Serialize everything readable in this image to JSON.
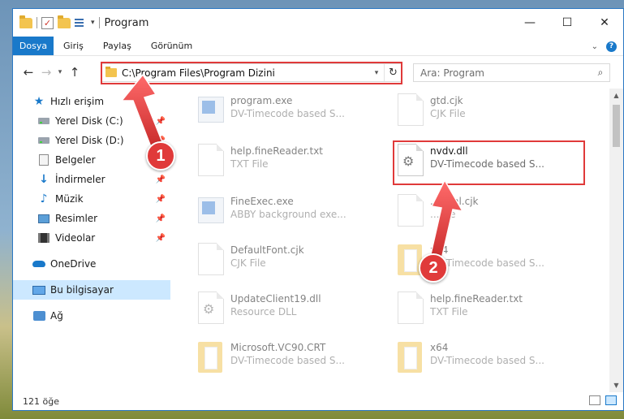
{
  "window": {
    "title": "Program",
    "controls": {
      "minimize": "—",
      "maximize": "☐",
      "close": "✕"
    }
  },
  "ribbon": {
    "tabs": [
      {
        "label": "Dosya",
        "active": true
      },
      {
        "label": "Giriş"
      },
      {
        "label": "Paylaş"
      },
      {
        "label": "Görünüm"
      }
    ]
  },
  "address": {
    "path": "C:\\Program Files\\Program Dizini"
  },
  "search": {
    "placeholder": "Ara: Program"
  },
  "sidebar": {
    "items": [
      {
        "label": "Hızlı erişim",
        "icon": "star-icon",
        "pinned": false
      },
      {
        "label": "Yerel Disk (C:)",
        "icon": "drive-icon",
        "pinned": true
      },
      {
        "label": "Yerel Disk (D:)",
        "icon": "drive-icon",
        "pinned": true
      },
      {
        "label": "Belgeler",
        "icon": "documents-icon",
        "pinned": true
      },
      {
        "label": "İndirmeler",
        "icon": "download-icon",
        "pinned": true
      },
      {
        "label": "Müzik",
        "icon": "music-icon",
        "pinned": true
      },
      {
        "label": "Resimler",
        "icon": "pictures-icon",
        "pinned": true
      },
      {
        "label": "Videolar",
        "icon": "video-icon",
        "pinned": true
      },
      {
        "label": "OneDrive",
        "icon": "onedrive-icon",
        "pinned": false
      },
      {
        "label": "Bu bilgisayar",
        "icon": "computer-icon",
        "pinned": false,
        "selected": true
      },
      {
        "label": "Ağ",
        "icon": "network-icon",
        "pinned": false
      }
    ]
  },
  "files": [
    {
      "name": "program.exe",
      "type": "DV-Timecode based S...",
      "icon": "exe-icon",
      "faded": true
    },
    {
      "name": "gtd.cjk",
      "type": "CJK File",
      "icon": "document-icon",
      "faded": true
    },
    {
      "name": "help.fineReader.txt",
      "type": "TXT File",
      "icon": "document-icon",
      "faded": true
    },
    {
      "name": "nvdv.dll",
      "type": "DV-Timecode based S...",
      "icon": "dll-gear-icon",
      "faded": false,
      "highlighted": true
    },
    {
      "name": "FineExec.exe",
      "type": "ABBY background exe...",
      "icon": "exe-icon",
      "faded": true
    },
    {
      "name": "...html.cjk",
      "type": "...File",
      "icon": "document-icon",
      "faded": true
    },
    {
      "name": "DefaultFont.cjk",
      "type": "CJK File",
      "icon": "document-icon",
      "faded": true
    },
    {
      "name": "x64",
      "type": "DV-Timecode based S...",
      "icon": "folder-doc-icon",
      "faded": true
    },
    {
      "name": "UpdateClient19.dll",
      "type": "Resource DLL",
      "icon": "dll-gear-icon",
      "faded": true
    },
    {
      "name": "help.fineReader.txt",
      "type": "TXT File",
      "icon": "document-icon",
      "faded": true
    },
    {
      "name": "Microsoft.VC90.CRT",
      "type": "DV-Timecode based S...",
      "icon": "folder-doc-icon",
      "faded": true
    },
    {
      "name": "x64",
      "type": "DV-Timecode based S...",
      "icon": "folder-doc-icon",
      "faded": true
    }
  ],
  "status": {
    "count": "121 öğe"
  },
  "callouts": {
    "one": "1",
    "two": "2"
  },
  "colors": {
    "accent": "#1979ca",
    "annotation": "#e03a3a",
    "selection": "#cce8ff"
  }
}
